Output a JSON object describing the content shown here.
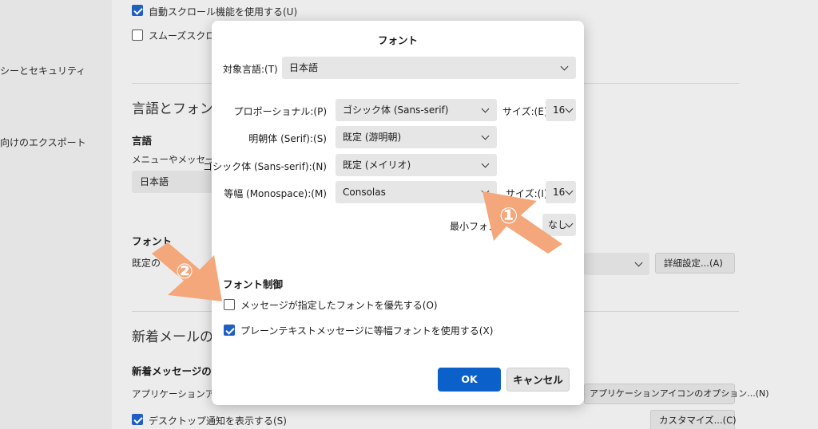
{
  "background": {
    "sidebar_items": [
      "シーとセキュリティ",
      "向けのエクスポート"
    ],
    "auto_scroll": "自動スクロール機能を使用する(U)",
    "smooth_scroll": "スムーズスクロール",
    "section_lang_font": "言語とフォント",
    "language_heading": "言語",
    "language_desc": "メニューやメッセージ、",
    "language_value": "日本語",
    "font_heading": "フォント",
    "font_default": "既定の",
    "advanced_button": "詳細設定...(A)",
    "section_new_mail": "新着メールの通",
    "new_msg_heading": "新着メッセージの通",
    "app_icon_text": "アプリケーションアイコ",
    "app_icon_button": "アプリケーションアイコンのオプション...(N)",
    "desktop_notify": "デスクトップ通知を表示する(S)",
    "customize_button": "カスタマイズ...(C)"
  },
  "dialog": {
    "title": "フォント",
    "target_language_label": "対象言語:(T)",
    "target_language_value": "日本語",
    "rows": [
      {
        "label": "プロポーショナル:(P)",
        "value": "ゴシック体 (Sans-serif)",
        "size_label": "サイズ:(E)",
        "size_value": "16"
      },
      {
        "label": "明朝体 (Serif):(S)",
        "value": "既定 (游明朝)"
      },
      {
        "label": "ゴシック体 (Sans-serif):(N)",
        "value": "既定 (メイリオ)"
      },
      {
        "label": "等幅 (Monospace):(M)",
        "value": "Consolas",
        "size_label": "サイズ:(I)",
        "size_value": "16"
      }
    ],
    "min_font_label": "最小フォン",
    "min_font_value": "なし",
    "font_control_heading": "フォント制御",
    "checkbox_prefer_msg_fonts": "メッセージが指定したフォントを優先する(O)",
    "checkbox_prefer_msg_fonts_checked": false,
    "checkbox_monospace_plain": "プレーンテキストメッセージに等幅フォントを使用する(X)",
    "checkbox_monospace_plain_checked": true,
    "ok_label": "OK",
    "cancel_label": "キャンセル"
  },
  "annotations": {
    "marker1": "①",
    "marker2": "②",
    "arrow_color": "#f3a77a"
  }
}
